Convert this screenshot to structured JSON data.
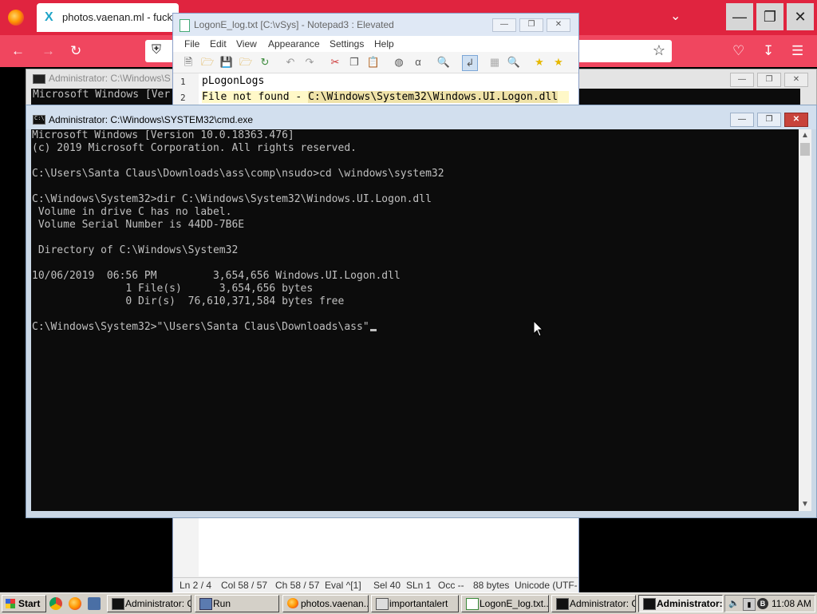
{
  "firefox": {
    "tab_title": "photos.vaenan.ml - fucky"
  },
  "cmd_bg": {
    "title": "Administrator: C:\\Windows\\S",
    "lines": [
      "Microsoft Windows [Ver"
    ]
  },
  "notepad": {
    "title": "LogonE_log.txt [C:\\vSys] - Notepad3 : Elevated",
    "menu": [
      "File",
      "Edit",
      "View",
      "Appearance",
      "Settings",
      "Help"
    ],
    "lines": [
      {
        "num": "1",
        "text": "pLogonLogs"
      },
      {
        "num": "2",
        "text_plain": "File not found - ",
        "text_highlight": "C:\\Windows\\System32\\Windows.UI.Logon.dll"
      }
    ],
    "status": {
      "ln": "Ln 2 / 4",
      "col": "Col 58 / 57",
      "ch": "Ch 58 / 57",
      "eval": "Eval ^[1]",
      "sel": "Sel 40",
      "sln": "SLn 1",
      "occ": "Occ --",
      "size": "88 bytes",
      "encoding": "Unicode (UTF-"
    }
  },
  "cmd": {
    "title": "Administrator: C:\\Windows\\SYSTEM32\\cmd.exe",
    "icon_text": "C:\\",
    "lines": [
      "Microsoft Windows [Version 10.0.18363.476]",
      "(c) 2019 Microsoft Corporation. All rights reserved.",
      "",
      "C:\\Users\\Santa Claus\\Downloads\\ass\\comp\\nsudo>cd \\windows\\system32",
      "",
      "C:\\Windows\\System32>dir C:\\Windows\\System32\\Windows.UI.Logon.dll",
      " Volume in drive C has no label.",
      " Volume Serial Number is 44DD-7B6E",
      "",
      " Directory of C:\\Windows\\System32",
      "",
      "10/06/2019  06:56 PM         3,654,656 Windows.UI.Logon.dll",
      "               1 File(s)      3,654,656 bytes",
      "               0 Dir(s)  76,610,371,584 bytes free",
      "",
      "C:\\Windows\\System32>\"\\Users\\Santa Claus\\Downloads\\ass\""
    ]
  },
  "taskbar": {
    "start_label": "Start",
    "tasks": [
      {
        "label": "Administrator: C..."
      },
      {
        "label": "Run"
      },
      {
        "label": "photos.vaenan..."
      },
      {
        "label": "importantalert"
      },
      {
        "label": "LogonE_log.txt..."
      },
      {
        "label": "Administrator: C..."
      },
      {
        "label": "Administrator:..."
      }
    ],
    "clock": "11:08 AM"
  },
  "colors": {
    "firefox_red": "#e0243f",
    "console_bg": "#0c0c0c",
    "console_fg": "#c0c0c0",
    "notepad_highlight": "#efe2a8"
  }
}
